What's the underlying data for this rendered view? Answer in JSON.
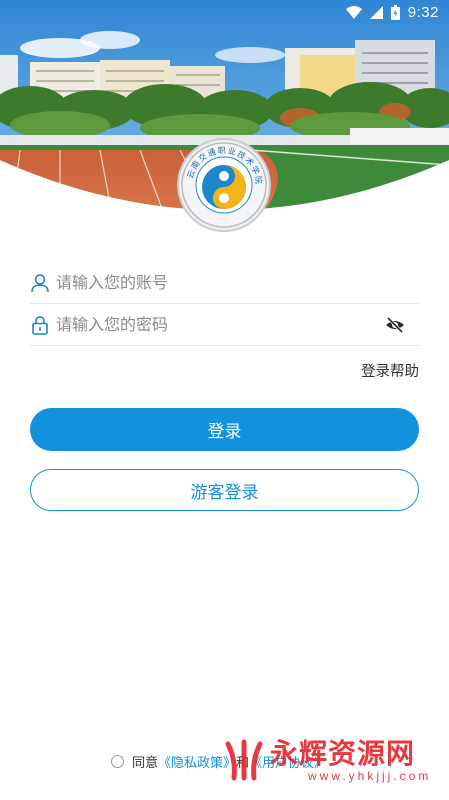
{
  "status_bar": {
    "time": "9:32",
    "icons": [
      "wifi-icon",
      "signal-icon",
      "battery-icon"
    ]
  },
  "banner": {
    "emblem_text": "云南交通职业技术学院",
    "colors": {
      "sky": "#3a8fd6",
      "track": "#d8673e",
      "field": "#3f8a3a",
      "emblem_blue": "#1c87c9",
      "emblem_yellow": "#f2b41b"
    }
  },
  "login_form": {
    "account": {
      "placeholder": "请输入您的账号",
      "value": "",
      "icon": "user-icon"
    },
    "password": {
      "placeholder": "请输入您的密码",
      "value": "",
      "icon": "lock-icon",
      "toggle_icon": "eye-off-icon"
    },
    "help_label": "登录帮助",
    "login_label": "登录",
    "guest_label": "游客登录"
  },
  "agreement": {
    "prefix": "同意",
    "privacy_link": "《隐私政策》",
    "conjunction": "和",
    "protocol_link": "《用户协议》",
    "checked": false
  },
  "watermark": {
    "text": "永辉资源网",
    "url": "www.yhkjjj.com"
  },
  "theme": {
    "primary": "#1491dc",
    "text": "#333333",
    "placeholder": "#8a8a8a"
  }
}
